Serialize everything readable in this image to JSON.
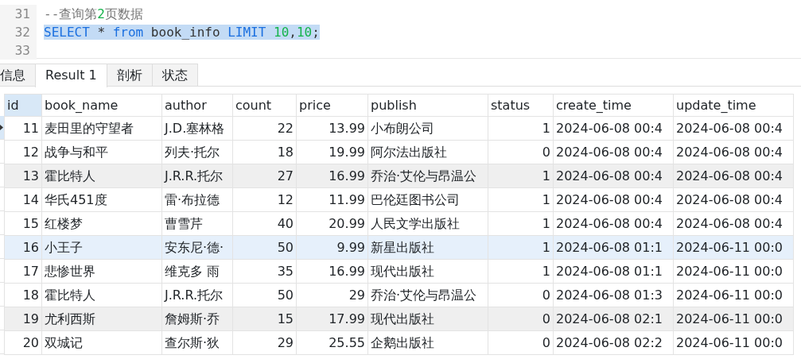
{
  "editor": {
    "lines": [
      {
        "number": "31",
        "selected": false,
        "tokens": [
          {
            "kind": "comment",
            "text": "--查询第"
          },
          {
            "kind": "number",
            "text": "2"
          },
          {
            "kind": "comment",
            "text": "页数据"
          }
        ]
      },
      {
        "number": "32",
        "selected": true,
        "tokens": [
          {
            "kind": "keyword",
            "text": "SELECT"
          },
          {
            "kind": "plain",
            "text": " * "
          },
          {
            "kind": "keyword",
            "text": "from"
          },
          {
            "kind": "plain",
            "text": " book_info "
          },
          {
            "kind": "keyword",
            "text": "LIMIT "
          },
          {
            "kind": "number",
            "text": "10"
          },
          {
            "kind": "plain",
            "text": ","
          },
          {
            "kind": "number",
            "text": "10"
          },
          {
            "kind": "plain",
            "text": ";"
          }
        ]
      },
      {
        "number": "33",
        "selected": false
      }
    ]
  },
  "tabs": [
    {
      "label": "信息",
      "selected": false
    },
    {
      "label": "Result 1",
      "selected": true
    },
    {
      "label": "剖析",
      "selected": false
    },
    {
      "label": "状态",
      "selected": false
    }
  ],
  "table": {
    "columns": [
      {
        "label": "id",
        "kind": "number",
        "selected": true
      },
      {
        "label": "book_name",
        "kind": "text",
        "selected": false
      },
      {
        "label": "author",
        "kind": "text",
        "selected": false
      },
      {
        "label": "count",
        "kind": "number",
        "selected": false
      },
      {
        "label": "price",
        "kind": "number",
        "selected": false
      },
      {
        "label": "publish",
        "kind": "text",
        "selected": false
      },
      {
        "label": "status",
        "kind": "number",
        "selected": false
      },
      {
        "label": "create_time",
        "kind": "text",
        "selected": false
      },
      {
        "label": "update_time",
        "kind": "text",
        "selected": false
      }
    ],
    "rows": [
      {
        "selected": true,
        "shaded": false,
        "hovered": false,
        "cells": [
          "11",
          "麦田里的守望者",
          "J.D.塞林格",
          "22",
          "13.99",
          "小布朗公司",
          "1",
          "2024-06-08 00:4",
          "2024-06-08 00:4"
        ]
      },
      {
        "selected": false,
        "shaded": false,
        "hovered": false,
        "cells": [
          "12",
          "战争与和平",
          "列夫·托尔",
          "18",
          "19.99",
          "阿尔法出版社",
          "0",
          "2024-06-08 00:4",
          "2024-06-08 00:4"
        ]
      },
      {
        "selected": false,
        "shaded": true,
        "hovered": false,
        "cells": [
          "13",
          "霍比特人",
          "J.R.R.托尔",
          "27",
          "16.99",
          "乔治·艾伦与昂温公",
          "1",
          "2024-06-08 00:4",
          "2024-06-08 00:4"
        ]
      },
      {
        "selected": false,
        "shaded": false,
        "hovered": false,
        "cells": [
          "14",
          "华氏451度",
          "雷·布拉德",
          "12",
          "11.99",
          "巴伦廷图书公司",
          "1",
          "2024-06-08 00:4",
          "2024-06-08 00:4"
        ]
      },
      {
        "selected": false,
        "shaded": false,
        "hovered": false,
        "cells": [
          "15",
          "红楼梦",
          "曹雪芹",
          "40",
          "20.99",
          "人民文学出版社",
          "1",
          "2024-06-08 00:4",
          "2024-06-08 00:4"
        ]
      },
      {
        "selected": false,
        "shaded": false,
        "hovered": true,
        "cells": [
          "16",
          "小王子",
          "安东尼·德·",
          "50",
          "9.99",
          "新星出版社",
          "1",
          "2024-06-08 01:1",
          "2024-06-11 00:0"
        ]
      },
      {
        "selected": false,
        "shaded": false,
        "hovered": false,
        "cells": [
          "17",
          "悲惨世界",
          "维克多 雨",
          "35",
          "16.99",
          "现代出版社",
          "1",
          "2024-06-08 01:1",
          "2024-06-11 00:0"
        ]
      },
      {
        "selected": false,
        "shaded": false,
        "hovered": false,
        "cells": [
          "18",
          "霍比特人",
          "J.R.R.托尔",
          "50",
          "29",
          "乔治·艾伦与昂温公",
          "0",
          "2024-06-08 01:3",
          "2024-06-11 00:0"
        ]
      },
      {
        "selected": false,
        "shaded": true,
        "hovered": false,
        "cells": [
          "19",
          "尤利西斯",
          "詹姆斯·乔",
          "15",
          "17.99",
          "现代出版社",
          "0",
          "2024-06-08 02:1",
          "2024-06-11 00:0"
        ]
      },
      {
        "selected": false,
        "shaded": false,
        "hovered": false,
        "cells": [
          "20",
          "双城记",
          "查尔斯·狄",
          "29",
          "25.55",
          "企鹅出版社",
          "0",
          "2024-06-08 02:2",
          "2024-06-11 00:0"
        ]
      }
    ]
  }
}
